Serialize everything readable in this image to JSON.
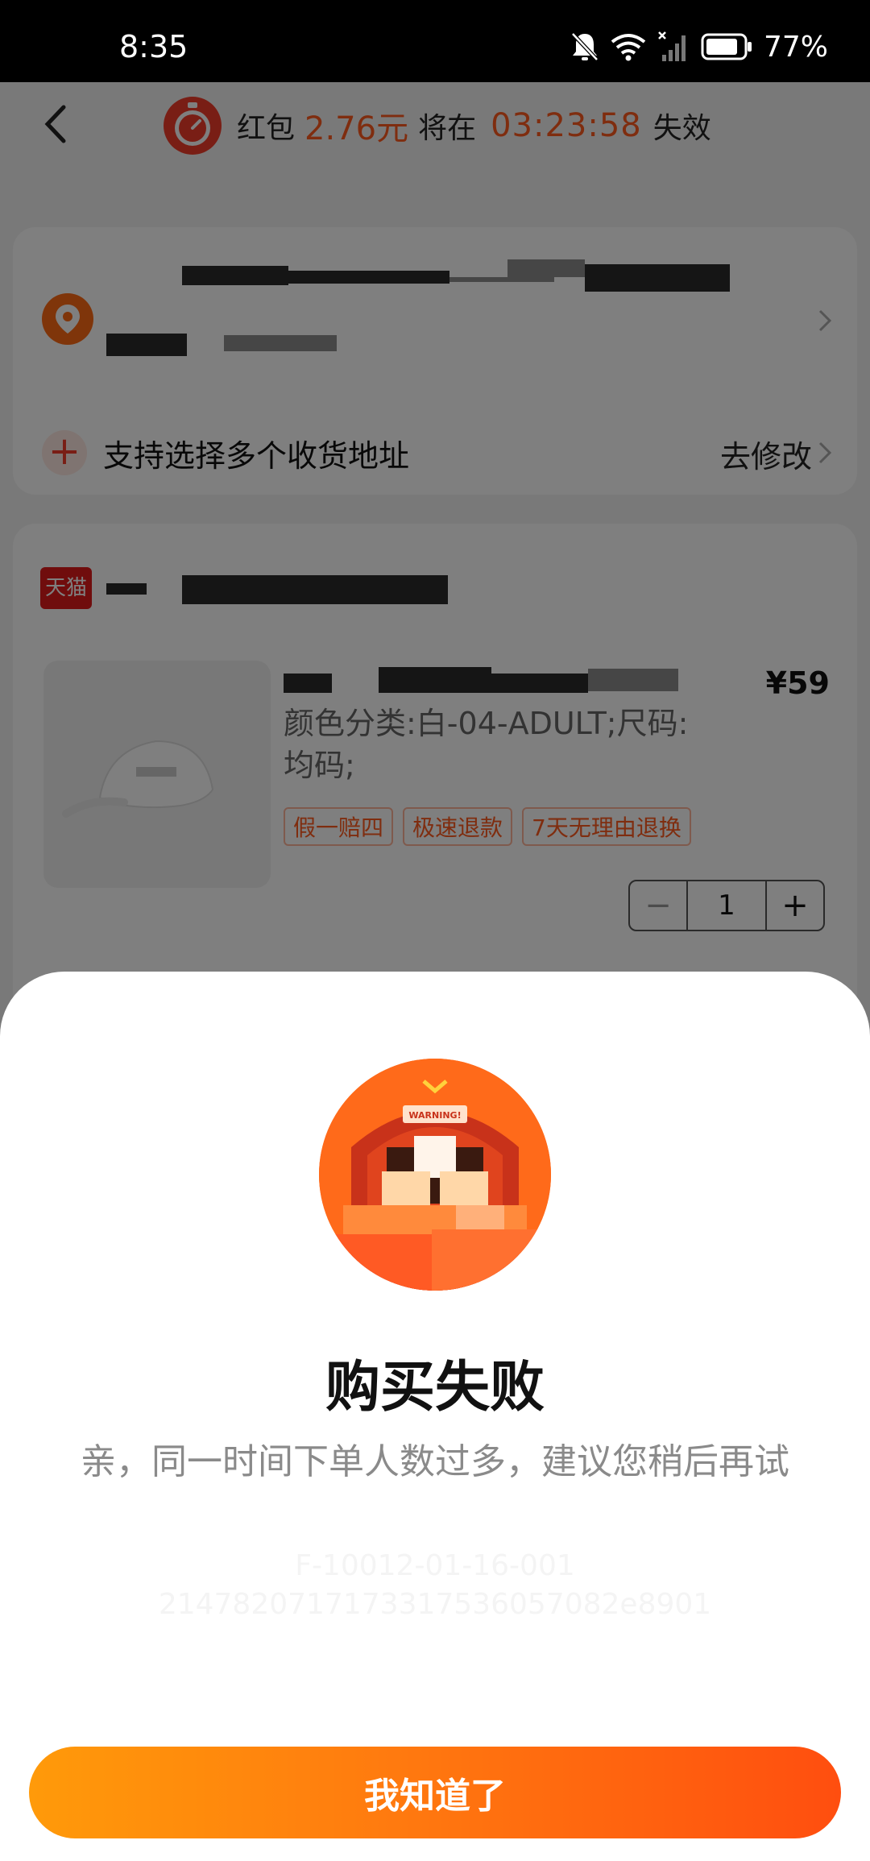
{
  "status_bar": {
    "time": "8:35",
    "battery": "77%",
    "icons": [
      "bell-muted-icon",
      "wifi-icon",
      "signal-icon",
      "battery-icon"
    ]
  },
  "header": {
    "prefix": "红包",
    "amount": "2.76元",
    "middle": "将在",
    "countdown": "03:23:58",
    "suffix": "失效"
  },
  "address_card": {
    "multi_address_label": "支持选择多个收货地址",
    "modify_label": "去修改"
  },
  "item_card": {
    "shop_logo": "天猫",
    "price": "¥59",
    "spec": "颜色分类:白-04-ADULT;尺码:均码;",
    "tags": [
      "假一赔四",
      "极速退款",
      "7天无理由退换"
    ],
    "quantity": "1",
    "minus": "−",
    "plus": "+"
  },
  "dialog": {
    "title": "购买失败",
    "message": "亲，同一时间下单人数过多，建议您稍后再试",
    "code_line1": "F-10012-01-16-001",
    "code_line2": "2147820717173317536057082e8901",
    "illustration_text": "WARNING!",
    "button_label": "我知道了"
  },
  "colors": {
    "accent": "#ff5a1f",
    "button_start": "#ff9a0a",
    "button_end": "#ff4e0f"
  }
}
